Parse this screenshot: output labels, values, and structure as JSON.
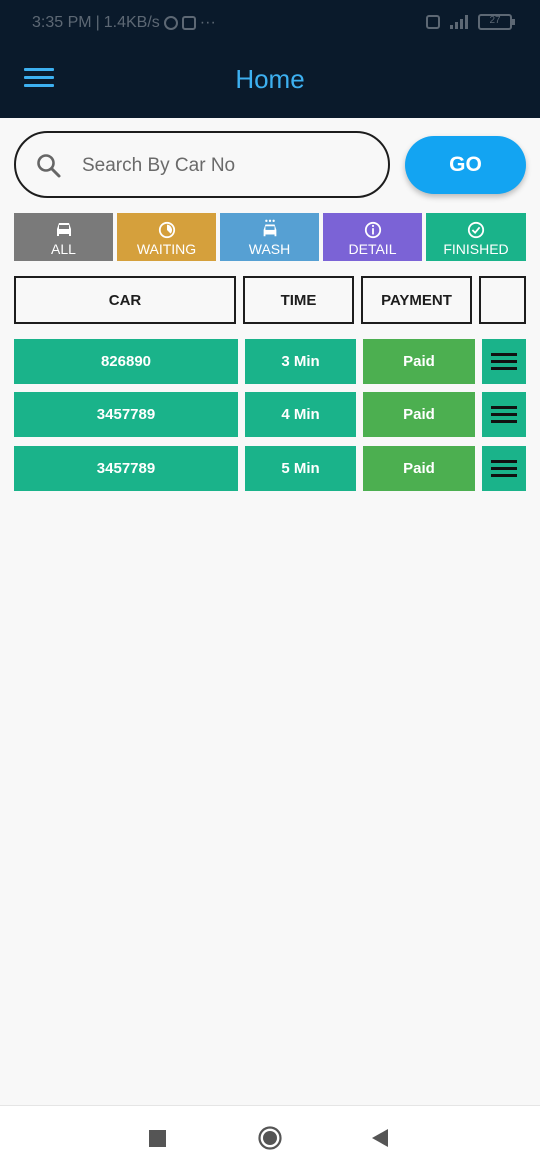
{
  "status_bar": {
    "time": "3:35 PM",
    "net_speed": "1.4KB/s",
    "more": "···",
    "battery": "27"
  },
  "app_bar": {
    "title": "Home"
  },
  "search": {
    "placeholder": "Search By Car No",
    "value": "",
    "button_label": "GO"
  },
  "tabs": [
    {
      "label": "ALL",
      "icon": "car-icon",
      "color": "#7a7a7a"
    },
    {
      "label": "WAITING",
      "icon": "clock-icon",
      "color": "#d5a03c"
    },
    {
      "label": "WASH",
      "icon": "car-wash-icon",
      "color": "#56a0d3"
    },
    {
      "label": "DETAIL",
      "icon": "info-icon",
      "color": "#7b63d6"
    },
    {
      "label": "FINISHED",
      "icon": "check-circle-icon",
      "color": "#1ab38a"
    }
  ],
  "table": {
    "headers": {
      "car": "CAR",
      "time": "TIME",
      "payment": "PAYMENT",
      "action": ""
    },
    "rows": [
      {
        "car": "826890",
        "time": "3 Min",
        "payment": "Paid"
      },
      {
        "car": "3457789",
        "time": "4 Min",
        "payment": "Paid"
      },
      {
        "car": "3457789",
        "time": "5 Min",
        "payment": "Paid"
      }
    ]
  },
  "colors": {
    "app_bar_bg": "#0a1a2b",
    "accent": "#3db0f0",
    "go_button": "#13a4f2",
    "row_green": "#1ab38a",
    "paid_green": "#4caf50"
  }
}
